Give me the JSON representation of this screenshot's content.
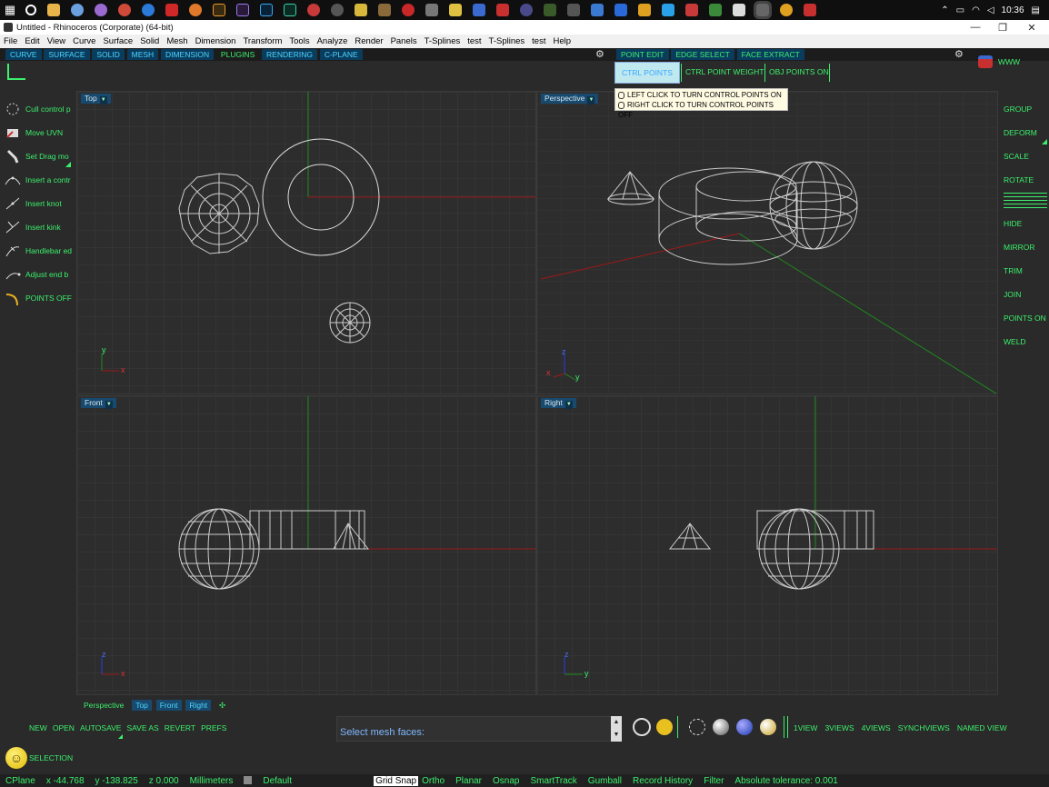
{
  "taskbar": {
    "time": "10:36"
  },
  "window": {
    "title": "Untitled - Rhinoceros (Corporate) (64-bit)"
  },
  "menu": [
    "File",
    "Edit",
    "View",
    "Curve",
    "Surface",
    "Solid",
    "Mesh",
    "Dimension",
    "Transform",
    "Tools",
    "Analyze",
    "Render",
    "Panels",
    "T-Splines",
    "test",
    "T-Splines",
    "test",
    "Help"
  ],
  "command_tabs": [
    "CURVE",
    "SURFACE",
    "SOLID",
    "MESH",
    "DIMENSION",
    "PLUGINS",
    "RENDERING",
    "C-PLANE"
  ],
  "edit_tabs": [
    "POINT EDIT",
    "EDGE SELECT",
    "FACE EXTRACT"
  ],
  "point_buttons": {
    "ctrl_points_on": "CTRL POINTS ON",
    "ctrl_point_weight": "CTRL POINT WEIGHT",
    "obj_points_on": "OBJ POINTS ON"
  },
  "www": "WWW",
  "tooltip": {
    "left": "LEFT CLICK TO TURN CONTROL POINTS ON",
    "right": "RIGHT CLICK TO TURN CONTROL POINTS OFF"
  },
  "left_tools": [
    "Cull control p",
    "Move UVN",
    "Set Drag mo",
    "Insert a contr",
    "Insert knot",
    "Insert kink",
    "Handlebar ed",
    "Adjust end b",
    "POINTS OFF"
  ],
  "right_tools": [
    "GROUP",
    "DEFORM",
    "SCALE",
    "ROTATE",
    "HIDE",
    "MIRROR",
    "TRIM",
    "JOIN",
    "POINTS ON",
    "WELD"
  ],
  "viewports": {
    "top": "Top",
    "perspective": "Perspective",
    "front": "Front",
    "right": "Right"
  },
  "axes": {
    "x": "x",
    "y": "y",
    "z": "z"
  },
  "view_tabs": [
    "Perspective",
    "Top",
    "Front",
    "Right"
  ],
  "file_buttons": [
    "NEW",
    "OPEN",
    "AUTOSAVE",
    "SAVE AS",
    "REVERT",
    "PREFS"
  ],
  "command_prompt": "Select mesh faces:",
  "view_buttons": [
    "1VIEW",
    "3VIEWS",
    "4VIEWS",
    "SYNCHVIEWS",
    "NAMED VIEW"
  ],
  "selection": "SELECTION",
  "status": {
    "cplane": "CPlane",
    "x": "x -44.768",
    "y": "y -138.825",
    "z": "z 0.000",
    "units": "Millimeters",
    "layer": "Default",
    "grid_snap": "Grid Snap",
    "ortho": "Ortho",
    "planar": "Planar",
    "osnap": "Osnap",
    "smarttrack": "SmartTrack",
    "gumball": "Gumball",
    "record_history": "Record History",
    "filter": "Filter",
    "tolerance": "Absolute tolerance: 0.001"
  },
  "colors": {
    "accent_green": "#3cf06c",
    "tab_blue": "#174a6e",
    "x_axis": "#a01818",
    "y_axis": "#1f8a1f"
  }
}
